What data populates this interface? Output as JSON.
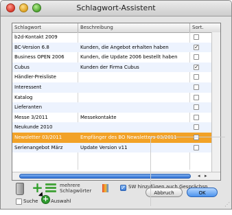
{
  "window": {
    "title": "Schlagwort-Assistent"
  },
  "table": {
    "headers": [
      "Schlagwort",
      "Beschreibung",
      "Sort."
    ],
    "rows": [
      {
        "schlagwort": "b2d-Kontakt 2009",
        "beschreibung": "",
        "sort": "☐"
      },
      {
        "schlagwort": "BC-Version 6.8",
        "beschreibung": "Kunden, die Angebot erhalten haben",
        "sort": "✓"
      },
      {
        "schlagwort": "Business OPEN 2006",
        "beschreibung": "Kunden, die Update 2006 bestellt haben",
        "sort": "☐"
      },
      {
        "schlagwort": "Cubus",
        "beschreibung": "Kunden der Firma Cubus",
        "sort": "✓"
      },
      {
        "schlagwort": "Händler-Preisliste",
        "beschreibung": "",
        "sort": "☐"
      },
      {
        "schlagwort": "Interessent",
        "beschreibung": "",
        "sort": "☐"
      },
      {
        "schlagwort": "Katalog",
        "beschreibung": "",
        "sort": "☐"
      },
      {
        "schlagwort": "Lieferanten",
        "beschreibung": "",
        "sort": "☐"
      },
      {
        "schlagwort": "Messe 3/2011",
        "beschreibung": "Messekontakte",
        "sort": "☐"
      },
      {
        "schlagwort": "Neukunde 2010",
        "beschreibung": "",
        "sort": "☐"
      },
      {
        "schlagwort": "Newsletter 03/2011",
        "beschreibung": "Empfänger des BO Newsletters 03/2011",
        "sort": "☐"
      },
      {
        "schlagwort": "Serienangebot März",
        "beschreibung": "Update Version v11",
        "sort": "☐"
      }
    ],
    "selected_row": "Newsletter 03/2011"
  },
  "toolbar": {
    "trash_icon": "trash-icon",
    "add_icon": "plus-icon",
    "list_icon": "list-icon",
    "multi_label_line1": "mehrere",
    "multi_label_line2": "Schlagwörter",
    "books_icon": "books-icon",
    "sw_checkbox_label": "SW hinzufügen auch Gesprächsp.",
    "sw_checked": true,
    "suche_label": "Suche",
    "auswahl_label": "Auswahl"
  },
  "buttons": {
    "cancel": "Abbruch",
    "ok": "OK"
  },
  "colors": {
    "selection": "#f2a227",
    "accent_blue": "#4c93ed"
  }
}
